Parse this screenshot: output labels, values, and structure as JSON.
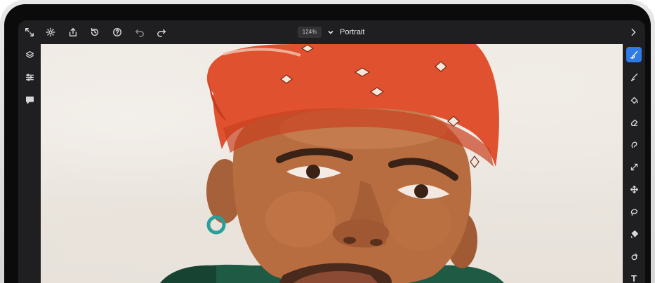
{
  "toolbar": {
    "zoom_level": "124%",
    "document_title": "Portrait",
    "buttons": [
      {
        "name": "fullscreen-icon"
      },
      {
        "name": "gear-icon"
      },
      {
        "name": "share-icon"
      },
      {
        "name": "history-icon"
      },
      {
        "name": "help-icon"
      },
      {
        "name": "undo-icon"
      },
      {
        "name": "redo-icon"
      },
      {
        "name": "chevron-right-icon"
      }
    ]
  },
  "left_panel": {
    "tools": [
      "layers-icon",
      "adjustments-icon",
      "comments-icon"
    ]
  },
  "right_panel": {
    "tools": [
      "paint-brush-icon",
      "brush-icon",
      "fill-icon",
      "eraser-icon",
      "smudge-icon",
      "transform-icon",
      "move-icon",
      "lasso-icon",
      "bucket-icon",
      "shape-icon",
      "text-icon",
      "eyedropper-icon"
    ],
    "active_tool": "paint-brush-icon",
    "text_tool_glyph": "T"
  },
  "colors": {
    "accent": "#2f7ae5",
    "bandana": "#e2512f",
    "skin": "#b56a3e",
    "background": "#efeae4"
  }
}
